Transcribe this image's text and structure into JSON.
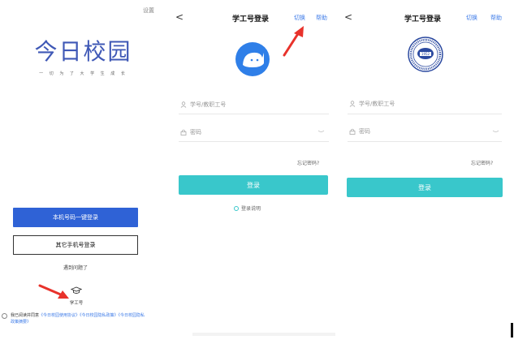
{
  "screen1": {
    "settings_label": "设置",
    "brand_title": "今日校园",
    "slogan": "一 切 为 了 大 学 生 成 长",
    "primary_button": "本机号码一键登录",
    "secondary_button": "其它手机号登录",
    "trouble_link": "遇到问题了",
    "student_id_label": "学工号",
    "agreement_text": "我已阅读并同意",
    "agreement_link1": "《今日校园使用协议》",
    "agreement_link2": "《今日校园隐私政策》",
    "agreement_link3": "《今日校园隐私政策摘要》"
  },
  "screen2": {
    "back_glyph": "<",
    "title": "学工号登录",
    "switch_label": "切换",
    "help_label": "帮助",
    "id_placeholder": "学号/教职工号",
    "password_placeholder": "密码",
    "forgot_label": "忘记密码?",
    "login_button": "登录",
    "login_help": "登录说明"
  },
  "screen3": {
    "back_glyph": "<",
    "title": "学工号登录",
    "switch_label": "切换",
    "help_label": "帮助",
    "id_placeholder": "学号/教职工号",
    "password_placeholder": "密码",
    "forgot_label": "忘记密码?",
    "login_button": "登录",
    "seal_year": "1952"
  },
  "colors": {
    "brand_blue": "#3f58b6",
    "primary_blue": "#2f62d6",
    "teal": "#39c7cb",
    "link_blue": "#3d7be8",
    "arrow_red": "#e8322b",
    "seal_blue": "#2c4aa0"
  }
}
